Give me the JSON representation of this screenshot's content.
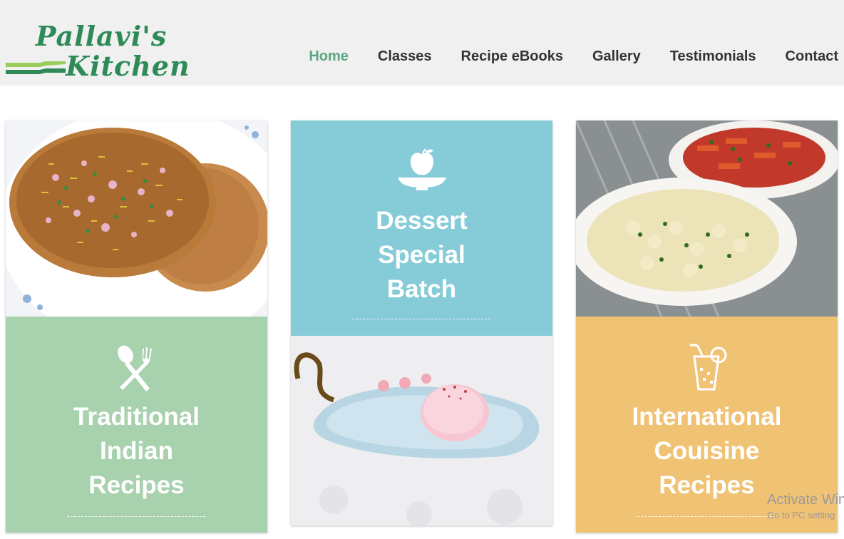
{
  "brand": {
    "line1": "Pallavi's",
    "line2": "Kitchen"
  },
  "nav": [
    {
      "label": "Home",
      "active": true
    },
    {
      "label": "Classes"
    },
    {
      "label": "Recipe eBooks"
    },
    {
      "label": "Gallery"
    },
    {
      "label": "Testimonials"
    },
    {
      "label": "Contact"
    }
  ],
  "cards": [
    {
      "icon": "spoon-fork-icon",
      "title": [
        "Traditional",
        "Indian",
        "Recipes"
      ],
      "color": "#a8d1ae",
      "photo": "paratha-photo"
    },
    {
      "icon": "fruit-bowl-icon",
      "title": [
        "Dessert",
        "Special",
        "Batch"
      ],
      "color": "#86cbd8",
      "photo": "ice-cream-photo"
    },
    {
      "icon": "drink-icon",
      "title": [
        "International",
        "Couisine",
        "Recipes"
      ],
      "color": "#f0c274",
      "photo": "pasta-photo"
    }
  ],
  "watermark": {
    "line1": "Activate Win",
    "line2": "Go to PC setting"
  }
}
